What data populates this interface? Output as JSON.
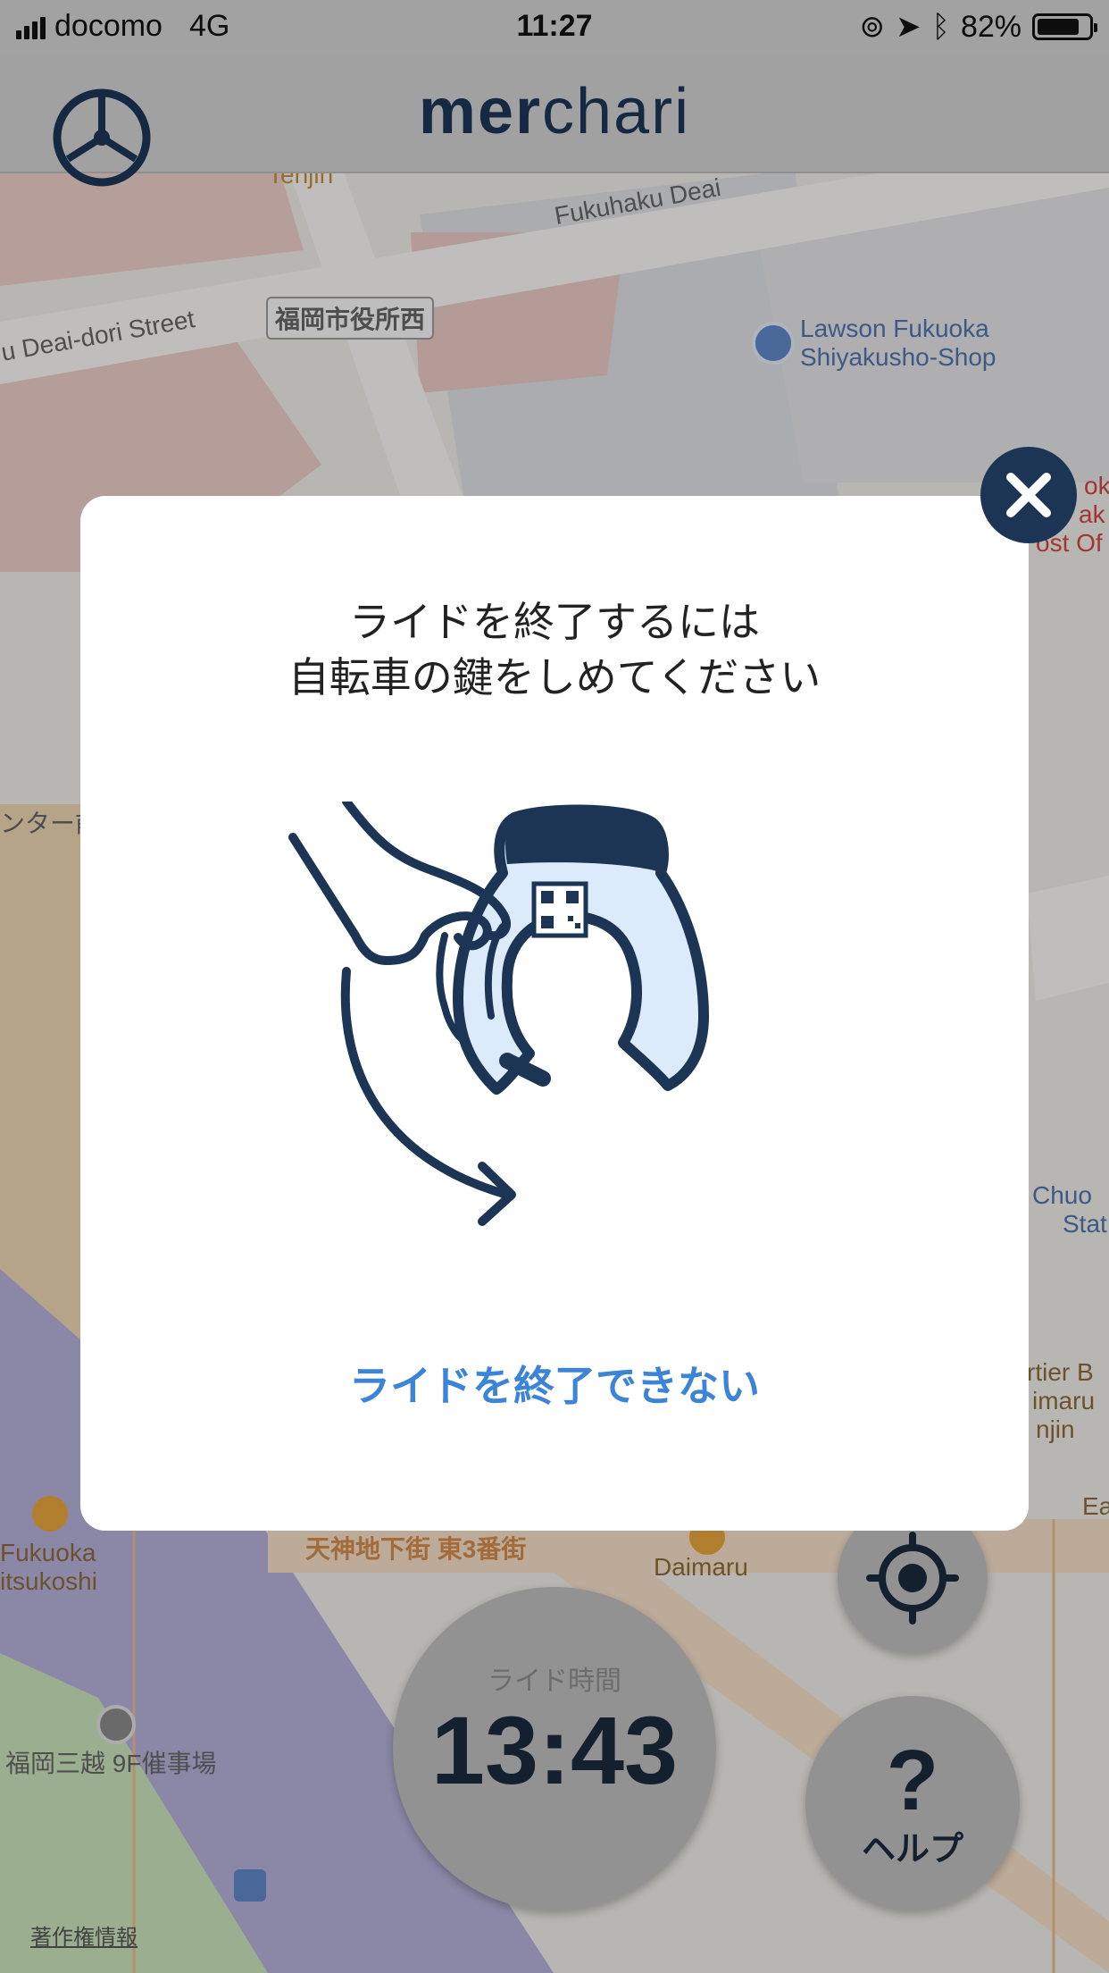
{
  "status_bar": {
    "carrier": "docomo",
    "network": "4G",
    "time": "11:27",
    "battery_percent": "82%",
    "battery_level": 0.82
  },
  "header": {
    "logo_part1": "mer",
    "logo_part2": "chari",
    "menu_icon": "wheel-icon"
  },
  "map": {
    "labels": {
      "tenjin": "Tenjin",
      "fukuhaku": "Fukuhaku Deai",
      "deai_street": "u Deai-dori Street",
      "city_hall_west": "福岡市役所西",
      "lawson_1": "Lawson Fukuoka",
      "lawson_2": "Shiyakusho-Shop",
      "center_mae": "ンター前",
      "chuo_1": "Chuo",
      "chuo_2": "Stat",
      "cartier_1": "rtier B",
      "cartier_2": "imaru",
      "cartier_3": "njin",
      "fukuoka_1": "Fukuoka",
      "fukuoka_2": "itsukoshi",
      "tenjin_chika": "天神地下街 東3番街",
      "daimaru": "Daimaru",
      "mitsukoshi_event": "福岡三越 9F催事場",
      "ea": "Ea",
      "post_1": "ok",
      "post_2": "ak",
      "post_3": "ost Of"
    }
  },
  "ride": {
    "label": "ライド時間",
    "time": "13:43"
  },
  "help": {
    "icon": "?",
    "label": "ヘルプ"
  },
  "copyright": "著作権情報",
  "modal": {
    "title_line1": "ライドを終了するには",
    "title_line2": "自転車の鍵をしめてください",
    "link": "ライドを終了できない",
    "close_icon": "close-icon"
  },
  "colors": {
    "brand_navy": "#1c3555",
    "link_blue": "#3c84d8",
    "lock_fill": "#dcebfb"
  }
}
